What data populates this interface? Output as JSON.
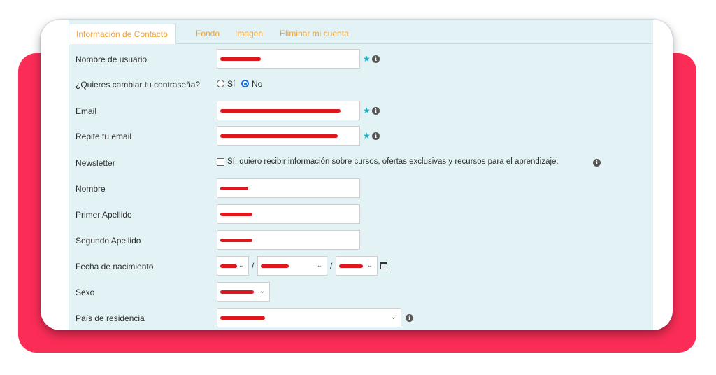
{
  "tabs": [
    {
      "label": "Información de Contacto",
      "active": true
    },
    {
      "label": "Fondo",
      "active": false
    },
    {
      "label": "Imagen",
      "active": false
    },
    {
      "label": "Eliminar mi cuenta",
      "active": false
    }
  ],
  "form": {
    "username": {
      "label": "Nombre de usuario",
      "required_icon": "star-icon",
      "info_icon": "info-icon"
    },
    "change_password": {
      "label": "¿Quieres cambiar tu contraseña?",
      "options": [
        "Sí",
        "No"
      ],
      "selected": "No"
    },
    "email": {
      "label": "Email",
      "required_icon": "star-icon"
    },
    "repeat_email": {
      "label": "Repite tu email",
      "required_icon": "star-icon"
    },
    "newsletter": {
      "label": "Newsletter",
      "checkbox_text": "Sí, quiero recibir información sobre cursos, ofertas exclusivas y recursos para el aprendizaje.",
      "checked": false
    },
    "first_name": {
      "label": "Nombre"
    },
    "last_name_1": {
      "label": "Primer Apellido"
    },
    "last_name_2": {
      "label": "Segundo Apellido"
    },
    "birth_date": {
      "label": "Fecha de nacimiento",
      "separator": "/",
      "calendar_icon": "calendar-icon"
    },
    "gender": {
      "label": "Sexo"
    },
    "country": {
      "label": "País de residencia"
    }
  },
  "colors": {
    "accent_tab": "#f0a23a",
    "star": "#19b6c9",
    "redaction": "#e0161d",
    "frame": "#fb2d57",
    "panel": "#e3f3f5"
  }
}
